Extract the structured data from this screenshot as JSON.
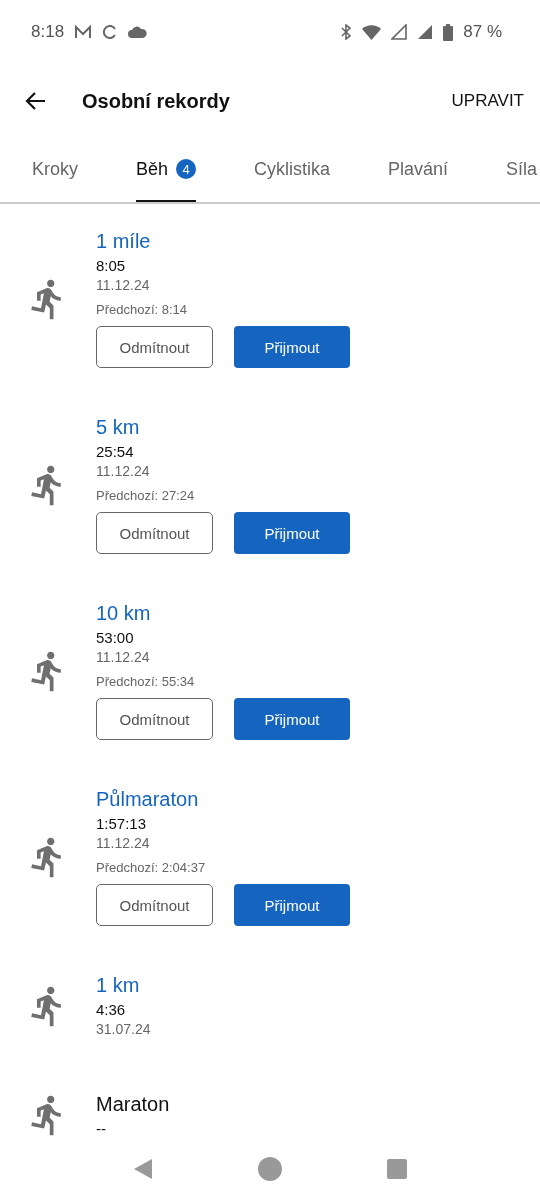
{
  "status_bar": {
    "time": "8:18",
    "battery": "87 %"
  },
  "header": {
    "title": "Osobní rekordy",
    "action": "UPRAVIT"
  },
  "tabs": [
    {
      "label": "Kroky",
      "selected": false
    },
    {
      "label": "Běh",
      "selected": true,
      "badge": "4"
    },
    {
      "label": "Cyklistika",
      "selected": false
    },
    {
      "label": "Plavání",
      "selected": false
    },
    {
      "label": "Síla",
      "selected": false
    }
  ],
  "records": [
    {
      "kind": "pending",
      "title": "1 míle",
      "value": "8:05",
      "date": "11.12.24",
      "previous": "Předchozí: 8:14",
      "reject": "Odmítnout",
      "accept": "Přijmout"
    },
    {
      "kind": "pending",
      "title": "5 km",
      "value": "25:54",
      "date": "11.12.24",
      "previous": "Předchozí: 27:24",
      "reject": "Odmítnout",
      "accept": "Přijmout"
    },
    {
      "kind": "pending",
      "title": "10 km",
      "value": "53:00",
      "date": "11.12.24",
      "previous": "Předchozí: 55:34",
      "reject": "Odmítnout",
      "accept": "Přijmout"
    },
    {
      "kind": "pending",
      "title": "Půlmaraton",
      "value": "1:57:13",
      "date": "11.12.24",
      "previous": "Předchozí: 2:04:37",
      "reject": "Odmítnout",
      "accept": "Přijmout"
    },
    {
      "kind": "achieved",
      "title": "1 km",
      "value": "4:36",
      "date": "31.07.24"
    },
    {
      "kind": "empty",
      "title": "Maraton",
      "value": "--"
    }
  ]
}
